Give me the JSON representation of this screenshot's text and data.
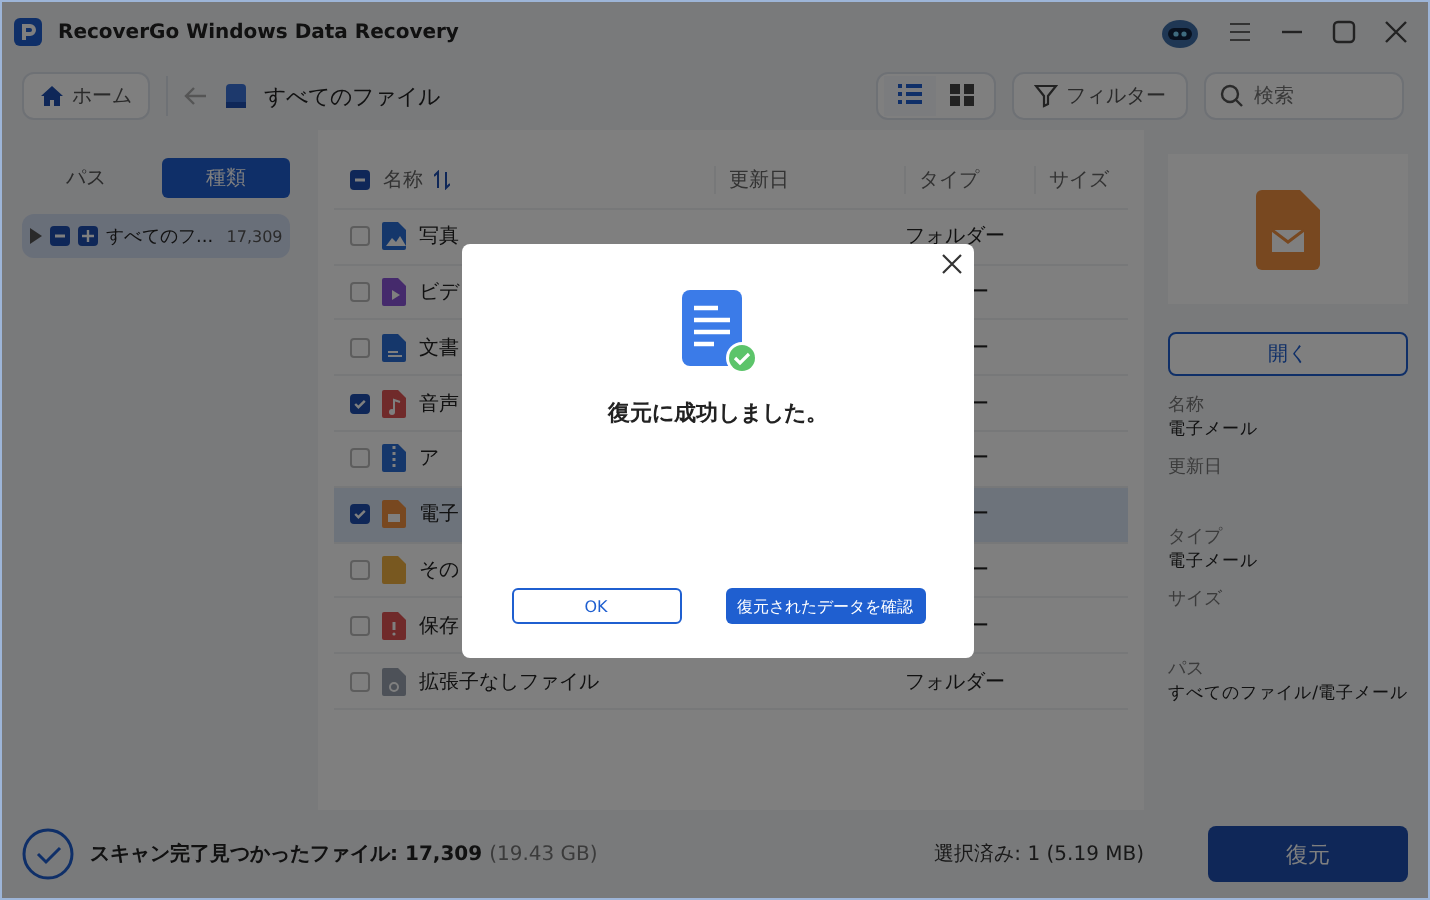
{
  "window": {
    "title": "RecoverGo Windows Data Recovery"
  },
  "toolbar": {
    "home": "ホーム",
    "location": "すべてのファイル",
    "view_modes": [
      {
        "kind": "list",
        "selected": true
      },
      {
        "kind": "grid",
        "selected": false
      }
    ],
    "filter": "フィルター",
    "search": {
      "placeholder": "検索"
    }
  },
  "sidebar": {
    "tabs": [
      {
        "label": "パス",
        "selected": false
      },
      {
        "label": "種類",
        "selected": true
      }
    ],
    "items": [
      {
        "label": "すべてのフ...",
        "count": "17,309",
        "selected": true,
        "expanded": false
      }
    ]
  },
  "table": {
    "columns": [
      "名称",
      "更新日",
      "タイプ",
      "サイズ"
    ],
    "rows": [
      {
        "name": "写真",
        "kind": "image",
        "checked": false,
        "selected": false,
        "type": "フォルダー",
        "type_cut": false
      },
      {
        "name": "ビデ",
        "kind": "video",
        "checked": false,
        "selected": false,
        "type": "ー",
        "type_cut": true
      },
      {
        "name": "文書",
        "kind": "doc",
        "checked": false,
        "selected": false,
        "type": "ー",
        "type_cut": true
      },
      {
        "name": "音声",
        "kind": "audio",
        "checked": true,
        "selected": false,
        "type": "ー",
        "type_cut": true
      },
      {
        "name": "ア",
        "kind": "archive",
        "checked": false,
        "selected": false,
        "type": "ー",
        "type_cut": true
      },
      {
        "name": "電子",
        "kind": "mail",
        "checked": true,
        "selected": true,
        "type": "ー",
        "type_cut": true
      },
      {
        "name": "その",
        "kind": "other",
        "checked": false,
        "selected": false,
        "type": "ー",
        "type_cut": true
      },
      {
        "name": "保存",
        "kind": "warn",
        "checked": false,
        "selected": false,
        "type": "ー",
        "type_cut": true
      },
      {
        "name": "拡張子なしファイル",
        "kind": "unknown",
        "checked": false,
        "selected": false,
        "type": "フォルダー",
        "type_cut": false
      }
    ]
  },
  "details": {
    "open_button": "開く",
    "fields": [
      {
        "label": "名称",
        "value": "電子メール"
      },
      {
        "label": "更新日"
      },
      {
        "label": "タイプ",
        "value": "電子メール"
      },
      {
        "label": "サイズ"
      },
      {
        "label": "パス",
        "value": "すべてのファイル/電子メール"
      }
    ]
  },
  "status_bar": {
    "summary": "スキャン完了見つかったファイル: 17,309",
    "size": "(19.43 GB)",
    "selected": "選択済み: 1 (5.19 MB)",
    "recover_button": "復元"
  },
  "dialog": {
    "message": "復元に成功しました。",
    "buttons": [
      {
        "label": "OK",
        "kind": "secondary"
      },
      {
        "label": "復元されたデータを確認",
        "kind": "primary"
      }
    ]
  }
}
